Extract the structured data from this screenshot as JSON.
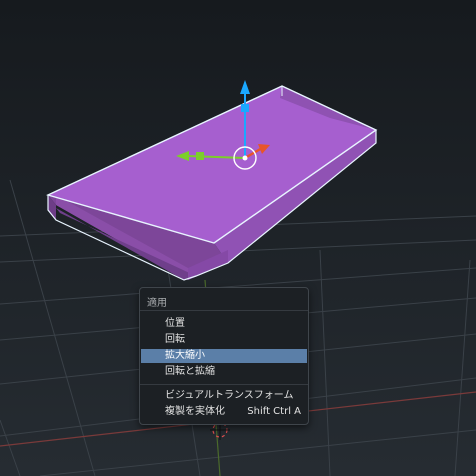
{
  "context_menu": {
    "title": "適用",
    "items": [
      {
        "label": "位置",
        "shortcut": "",
        "active": false
      },
      {
        "label": "回転",
        "shortcut": "",
        "active": false
      },
      {
        "label": "拡大縮小",
        "shortcut": "",
        "active": true
      },
      {
        "label": "回転と拡縮",
        "shortcut": "",
        "active": false
      },
      {
        "label": "ビジュアルトランスフォーム",
        "shortcut": "",
        "active": false
      },
      {
        "label": "複製を実体化",
        "shortcut": "Shift Ctrl A",
        "active": false
      }
    ]
  },
  "viewport": {
    "object_color": "#a65fcf",
    "outline_color": "#e8f4ff",
    "gizmo": {
      "z_axis_color": "#1aa8ff",
      "x_axis_color": "#e8552a",
      "y_axis_color": "#7ccf2a",
      "icons": [
        "move-gizmo-icon",
        "3d-cursor-icon"
      ]
    }
  }
}
